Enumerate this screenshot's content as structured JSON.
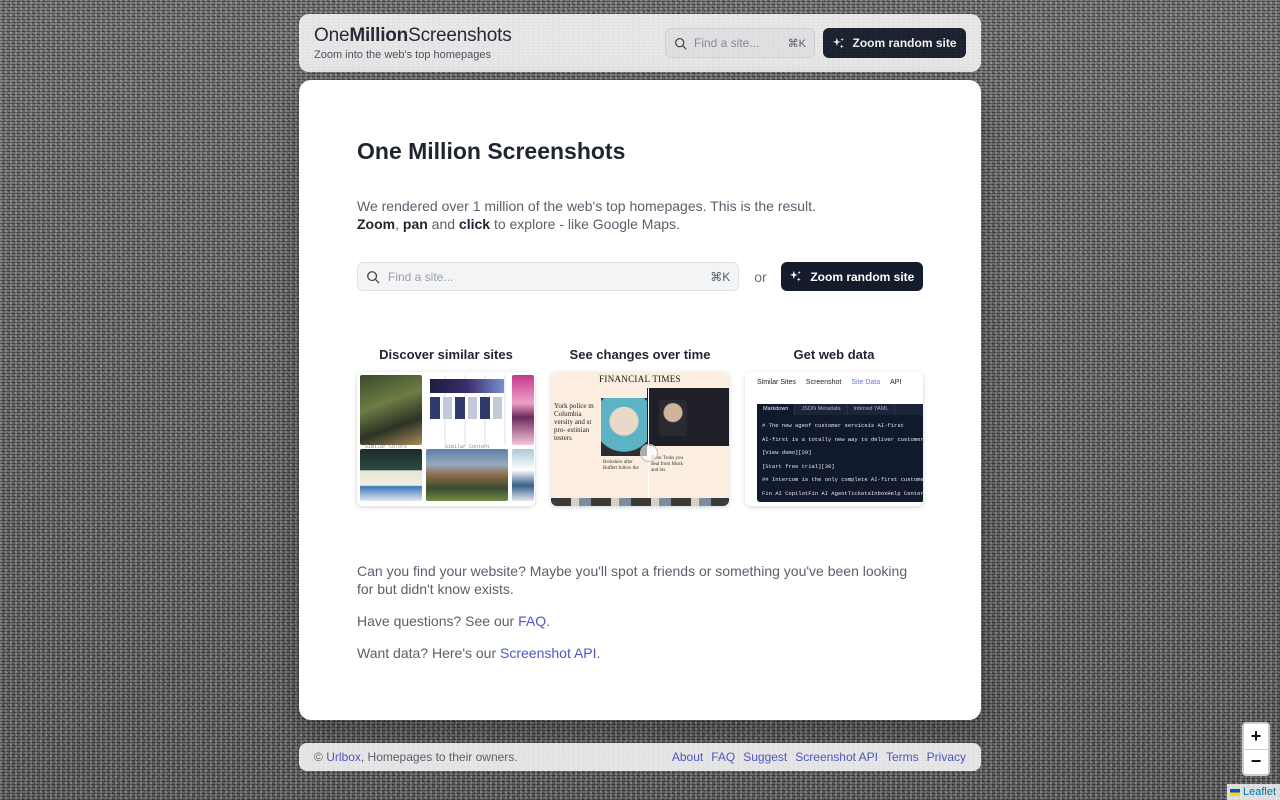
{
  "topbar": {
    "brand_one": "One",
    "brand_million": "Million",
    "brand_screenshots": "Screenshots",
    "subtitle": "Zoom into the web's top homepages",
    "search_placeholder": "Find a site...",
    "search_shortcut": "⌘K",
    "zoom_random_label": "Zoom random site"
  },
  "modal": {
    "title": "One Million Screenshots",
    "intro_line1": "We rendered over 1 million of the web's top homepages. This is the result.",
    "intro_zoom": "Zoom",
    "intro_comma": ", ",
    "intro_pan": "pan",
    "intro_and": " and ",
    "intro_click": "click",
    "intro_rest": " to explore - like Google Maps.",
    "search_placeholder": "Find a site...",
    "search_shortcut": "⌘K",
    "or_label": "or",
    "zoom_random_label": "Zoom random site",
    "features": [
      {
        "title": "Discover similar sites",
        "caption_left": "Similar Colors",
        "caption_right": "Similar Content"
      },
      {
        "title": "See changes over time",
        "masthead": "FINANCIAL TIMES",
        "headline": "York police m Columbia versity and st pro- estinian testers",
        "snippet_left": "Berkshire after Buffett follow the",
        "snippet_right": "Zohn Troks you deal from Musk and his"
      },
      {
        "title": "Get web data",
        "tabs": [
          "Similar Sites",
          "Screenshot",
          "Site Data",
          "API"
        ],
        "code_tabs": [
          "Markdown",
          "JSON Metadata",
          "Inferred YAML"
        ],
        "code_lines": [
          "# The new ageof customer serviceis AI-first",
          "AI-first is a totally new way to deliver customer se",
          "[View demo][29]",
          "[Start free trial][30]",
          "## Intercom is the only complete AI-first customer s",
          "Fin AI CopilotFin AI AgentTicketsInboxHelp CenterOmn"
        ]
      }
    ],
    "outro_1": "Can you find your website? Maybe you'll spot a friends or something you've been looking for but didn't know exists.",
    "outro_2_pre": "Have questions? See our ",
    "outro_2_link": "FAQ",
    "outro_2_post": ".",
    "outro_3_pre": "Want data? Here's our ",
    "outro_3_link": "Screenshot API",
    "outro_3_post": "."
  },
  "footer": {
    "copyright": "© ",
    "urlbox": "Urlbox",
    "rest": ", Homepages to their owners.",
    "links": [
      "About",
      "FAQ",
      "Suggest",
      "Screenshot API",
      "Terms",
      "Privacy"
    ]
  },
  "map": {
    "zoom_in": "+",
    "zoom_out": "−",
    "attribution": "Leaflet"
  },
  "colors": {
    "accent_button": "#141b2b",
    "link": "#4f56c9"
  }
}
